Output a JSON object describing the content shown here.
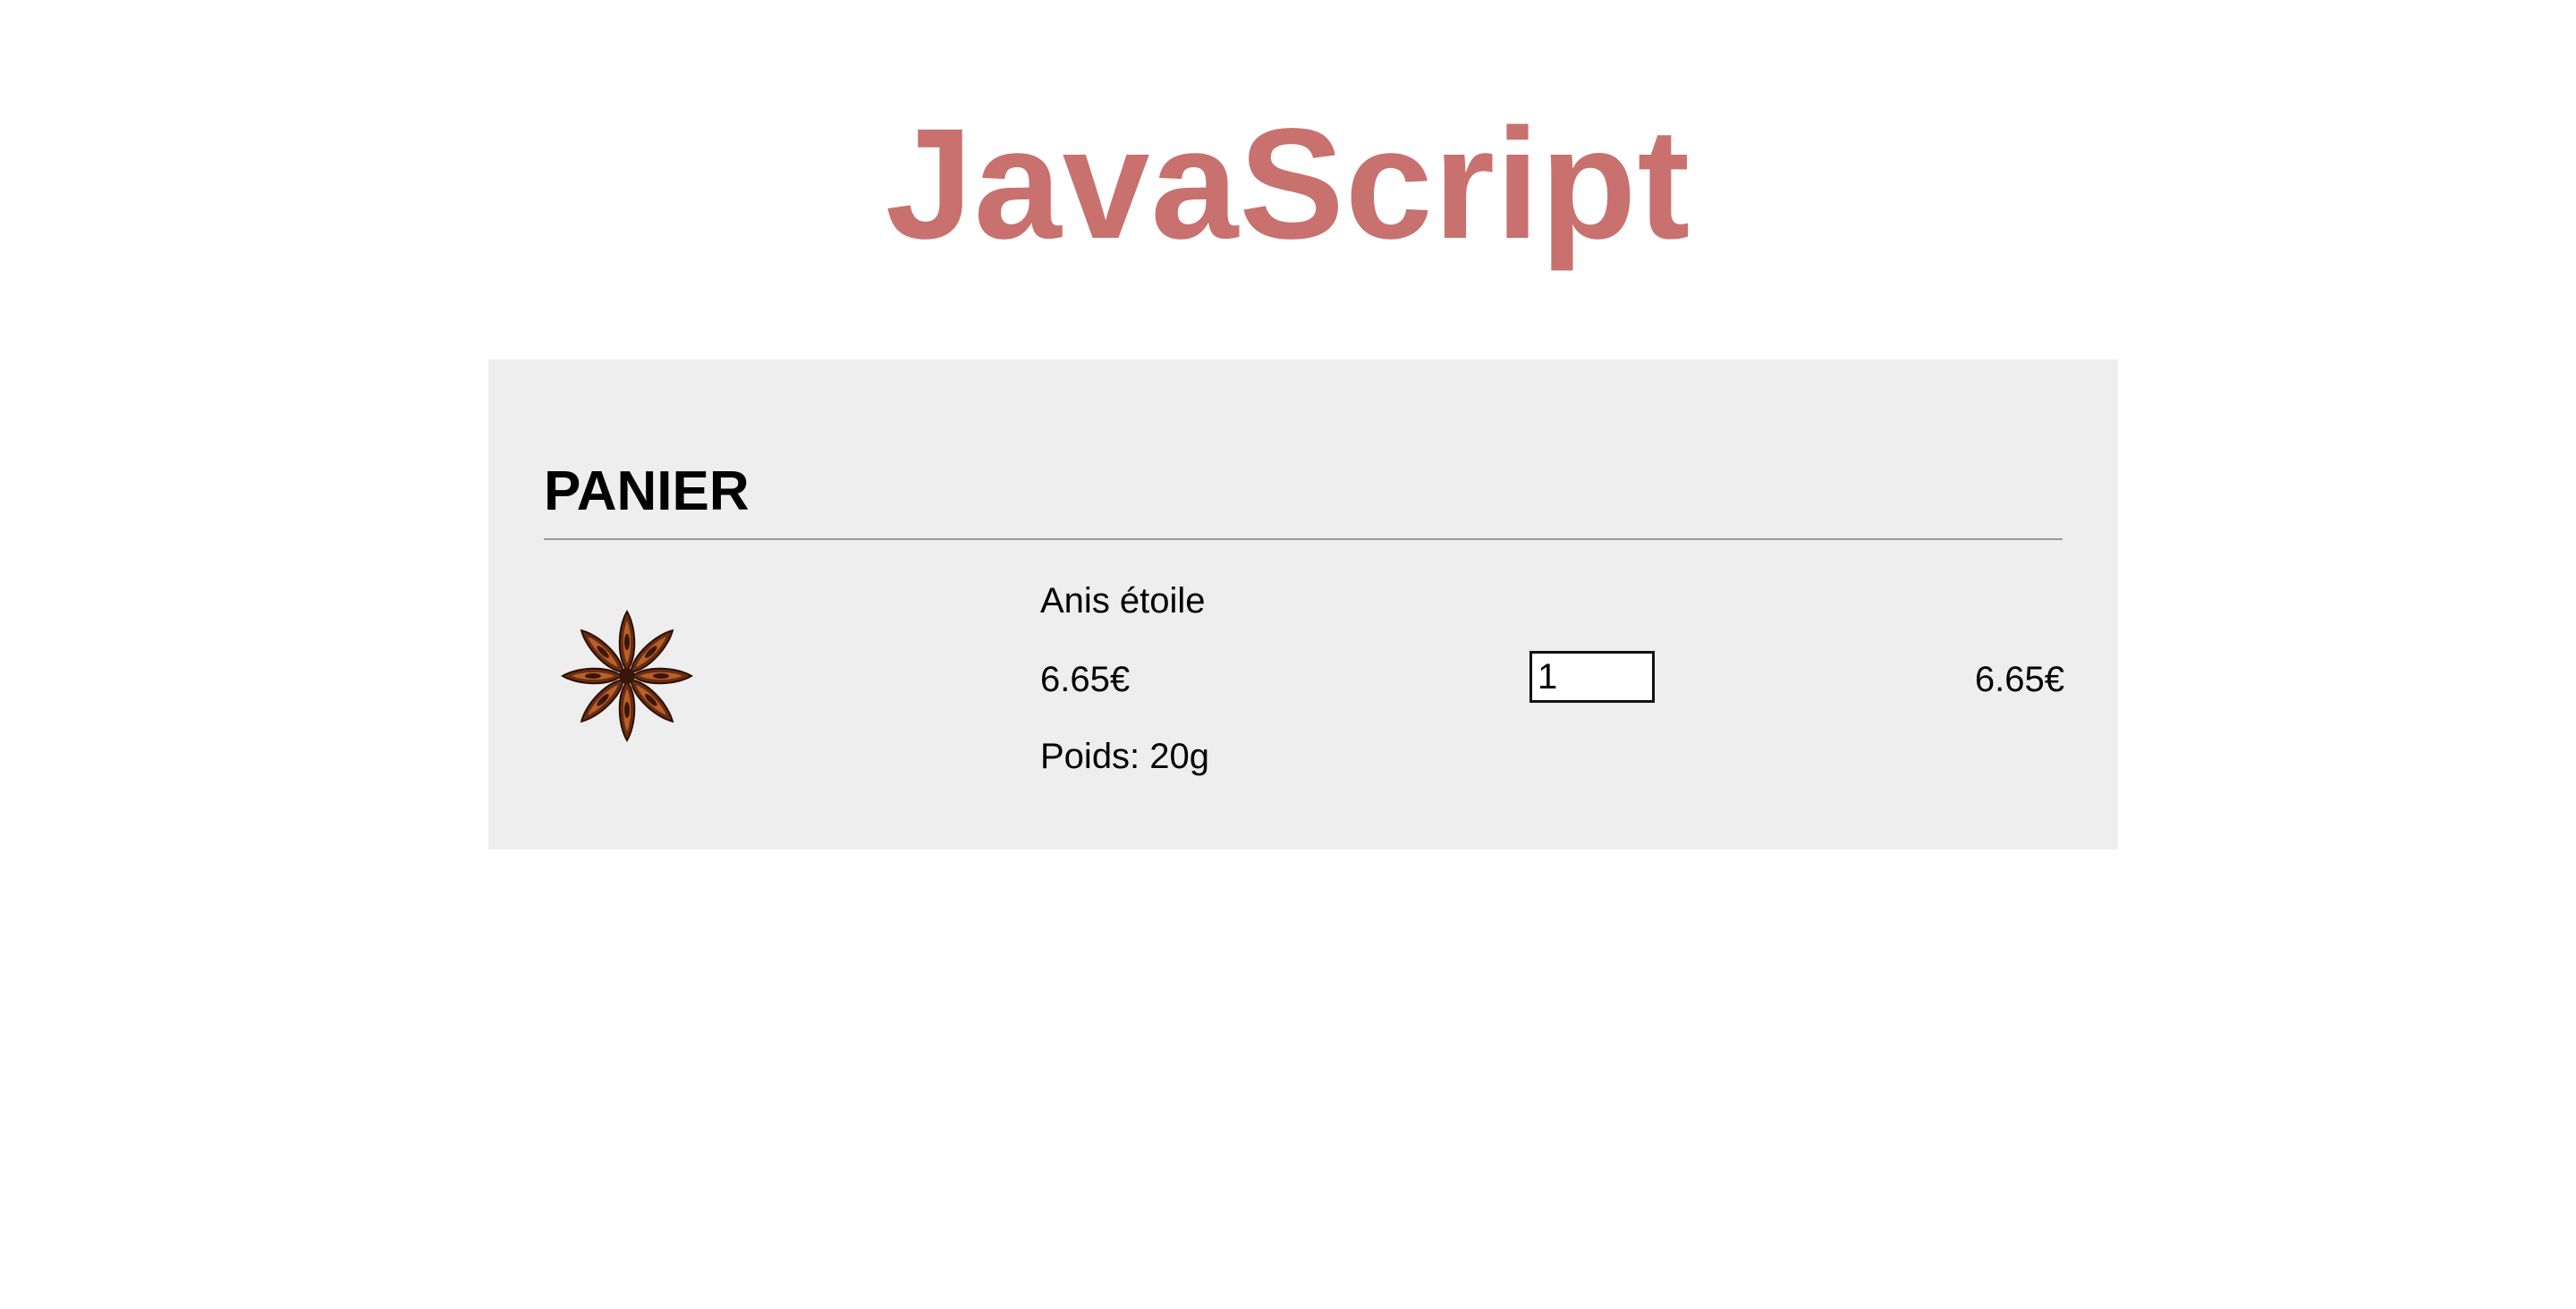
{
  "site": {
    "title": "JavaScript",
    "title_color": "#c8716e"
  },
  "cart": {
    "heading": "PANIER",
    "panel_color": "#eeeeee",
    "items": [
      {
        "image_icon": "star-anise-icon",
        "name": "Anis étoile",
        "price": "6.65€",
        "weight": "Poids: 20g",
        "quantity": "1",
        "line_total": "6.65€"
      }
    ]
  }
}
